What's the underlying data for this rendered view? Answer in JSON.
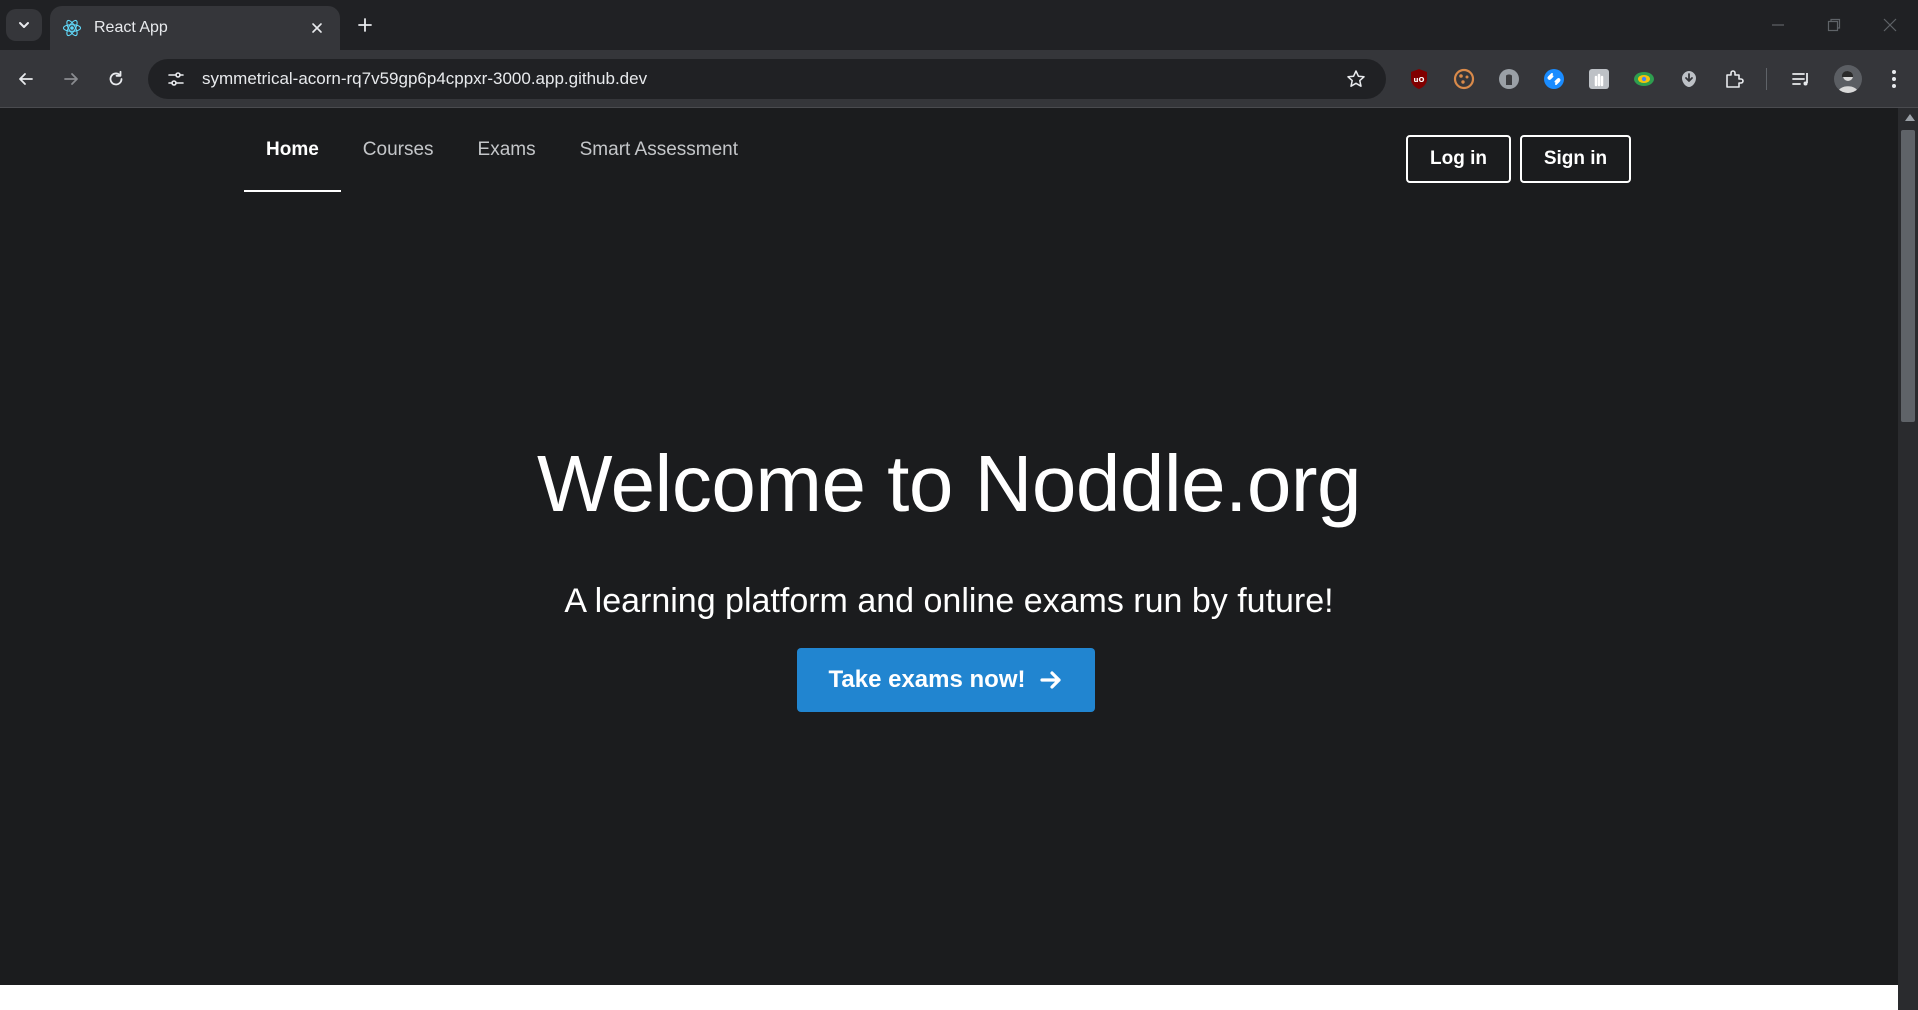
{
  "browser": {
    "tab_title": "React App",
    "url": "symmetrical-acorn-rq7v59gp6p4cppxr-3000.app.github.dev",
    "extensions": [
      "ublock-icon",
      "cookie-icon",
      "ghost-icon",
      "shazam-icon",
      "hand-icon",
      "color-icon",
      "download-icon",
      "puzzle-icon"
    ],
    "colors": {
      "tabbar": "#202124",
      "toolbar": "#35363a",
      "omnibox": "#202124"
    }
  },
  "nav": {
    "items": [
      {
        "label": "Home",
        "active": true
      },
      {
        "label": "Courses",
        "active": false
      },
      {
        "label": "Exams",
        "active": false
      },
      {
        "label": "Smart Assessment",
        "active": false
      }
    ],
    "login_label": "Log in",
    "signin_label": "Sign in"
  },
  "hero": {
    "title": "Welcome to Noddle.org",
    "subtitle": "A learning platform and online exams run by future!",
    "cta_label": "Take exams now!"
  },
  "colors": {
    "page_bg": "#1b1c1e",
    "cta": "#2185d0",
    "text": "#ffffff"
  }
}
